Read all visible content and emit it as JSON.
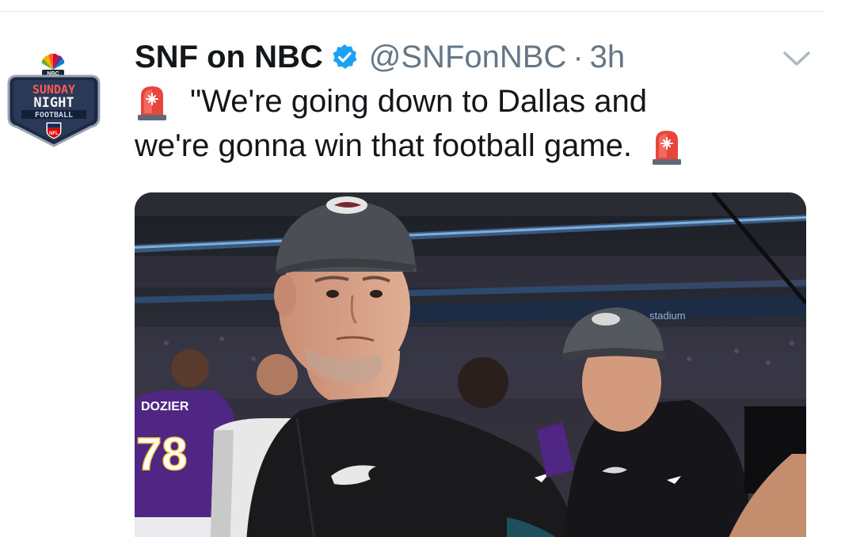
{
  "tweet": {
    "display_name": "SNF on NBC",
    "handle": "@SNFonNBC",
    "separator": "·",
    "time": "3h",
    "text_line1": "\"We're going down to Dallas and",
    "text_line2": "we're gonna win that football game.",
    "icons": {
      "verified": "verified-badge-icon",
      "more": "chevron-down-icon",
      "emoji": "rotating-light-emoji"
    }
  },
  "avatar": {
    "logo_network": "NBC",
    "logo_line1": "SUNDAY",
    "logo_line2": "NIGHT",
    "logo_line3": "FOOTBALL",
    "logo_shield": "NFL"
  },
  "photo": {
    "jersey_name": "DOZIER",
    "jersey_number": "78",
    "banner_text": "stadium"
  },
  "colors": {
    "text": "#14171a",
    "secondary": "#657786",
    "verified": "#1da1f2",
    "divider": "#e1e8ed",
    "siren_red": "#e8453c"
  }
}
